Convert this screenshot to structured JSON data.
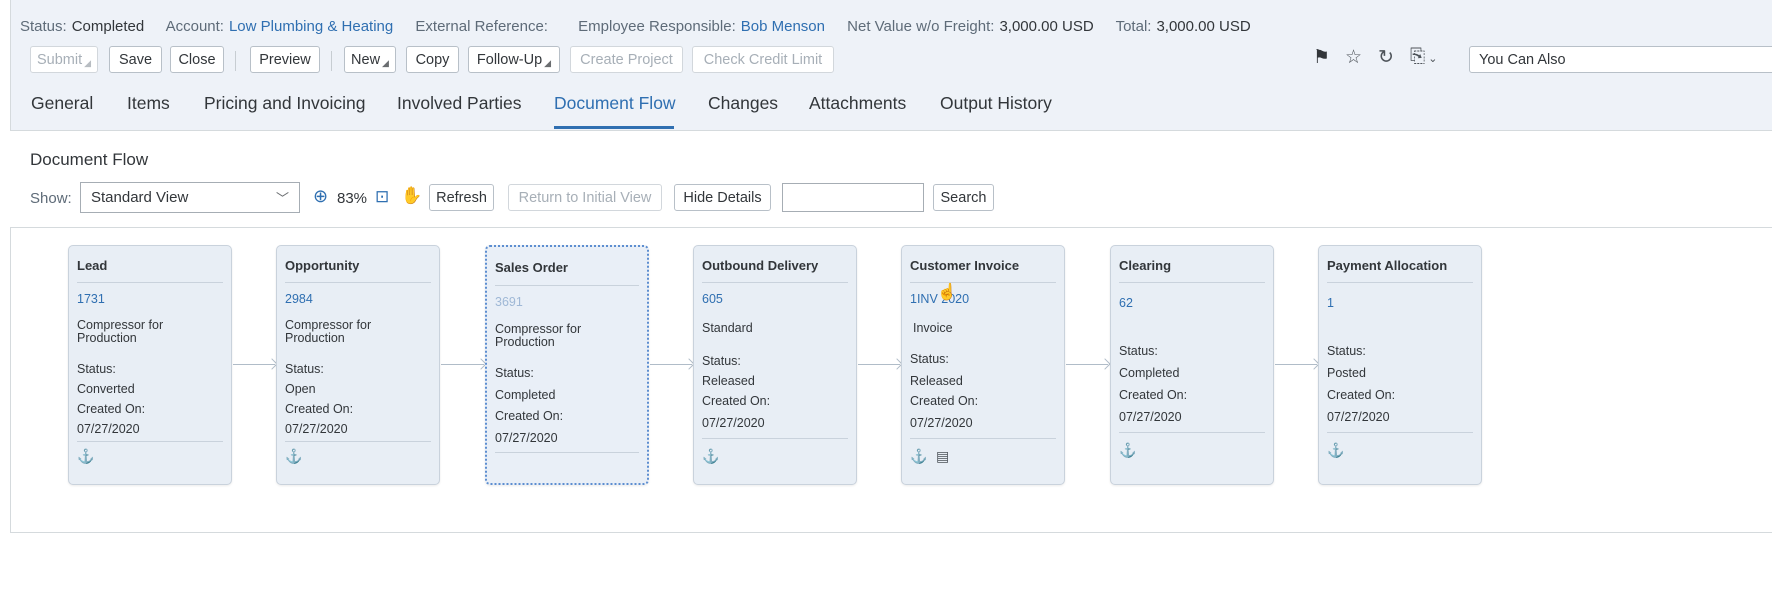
{
  "header": {
    "status_label": "Status:",
    "status_value": "Completed",
    "account_label": "Account:",
    "account_value": "Low Plumbing & Heating",
    "ext_ref_label": "External Reference:",
    "employee_label": "Employee Responsible:",
    "employee_value": "Bob Menson",
    "net_label": "Net Value w/o Freight:",
    "net_value": "3,000.00 USD",
    "total_label": "Total:",
    "total_value": "3,000.00 USD"
  },
  "toolbar": {
    "submit": "Submit",
    "save": "Save",
    "close": "Close",
    "preview": "Preview",
    "new": "New",
    "copy": "Copy",
    "follow_up": "Follow-Up",
    "create_project": "Create Project",
    "check_credit": "Check Credit Limit",
    "you_can_also": "You Can Also",
    "icons": [
      "flag-icon",
      "star-icon",
      "refresh-icon",
      "add-document-icon"
    ]
  },
  "tabs": [
    "General",
    "Items",
    "Pricing and Invoicing",
    "Involved Parties",
    "Document Flow",
    "Changes",
    "Attachments",
    "Output History"
  ],
  "active_tab": "Document Flow",
  "doc_flow": {
    "title": "Document Flow",
    "show_label": "Show:",
    "view_value": "Standard View",
    "zoom": "83%",
    "refresh": "Refresh",
    "return_initial": "Return to Initial View",
    "hide_details": "Hide Details",
    "search": "Search",
    "search_value": ""
  },
  "cards": [
    {
      "title": "Lead",
      "id": "1731",
      "desc": "Compressor for Production",
      "status_label": "Status:",
      "status": "Converted",
      "created_label": "Created On:",
      "created": "07/27/2020"
    },
    {
      "title": "Opportunity",
      "id": "2984",
      "desc": "Compressor for Production",
      "status_label": "Status:",
      "status": "Open",
      "created_label": "Created On:",
      "created": "07/27/2020"
    },
    {
      "title": "Sales Order",
      "id": "3691",
      "desc": "Compressor for Production",
      "status_label": "Status:",
      "status": "Completed",
      "created_label": "Created On:",
      "created": "07/27/2020"
    },
    {
      "title": "Outbound Delivery",
      "id": "605",
      "desc": "Standard",
      "status_label": "Status:",
      "status": "Released",
      "created_label": "Created On:",
      "created": "07/27/2020"
    },
    {
      "title": "Customer Invoice",
      "id": "1INV 2020",
      "desc": "Invoice",
      "status_label": "Status:",
      "status": "Released",
      "created_label": "Created On:",
      "created": "07/27/2020"
    },
    {
      "title": "Clearing",
      "id": "62",
      "desc": "",
      "status_label": "Status:",
      "status": "Completed",
      "created_label": "Created On:",
      "created": "07/27/2020"
    },
    {
      "title": "Payment Allocation",
      "id": "1",
      "desc": "",
      "status_label": "Status:",
      "status": "Posted",
      "created_label": "Created On:",
      "created": "07/27/2020"
    }
  ]
}
